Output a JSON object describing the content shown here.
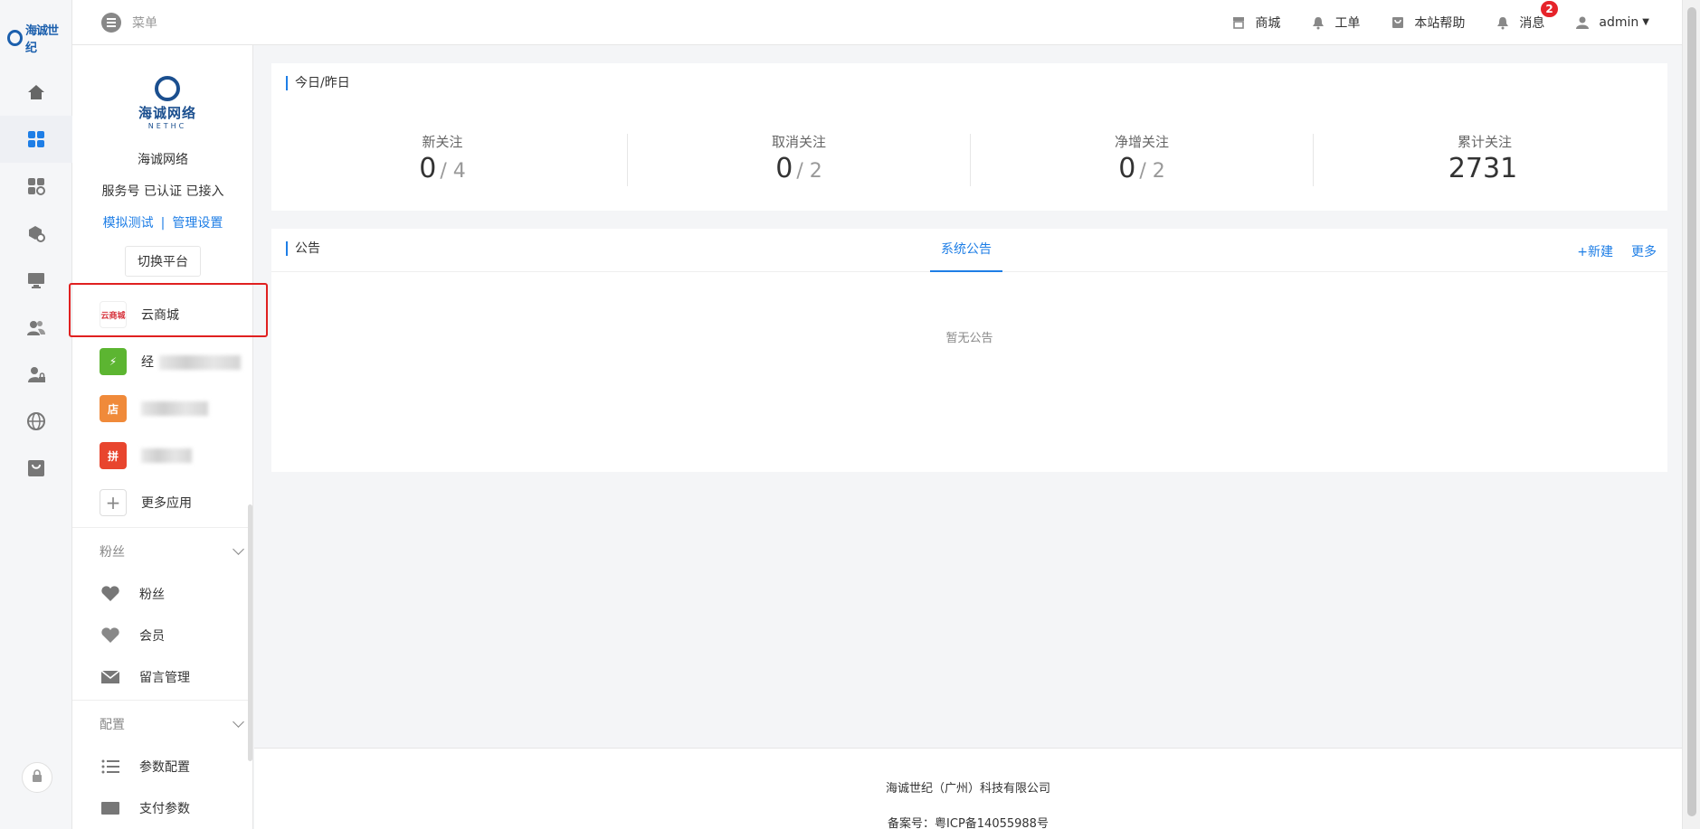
{
  "header": {
    "menu_label": "菜单",
    "items": [
      {
        "label": "商城",
        "icon": "store-icon"
      },
      {
        "label": "工单",
        "icon": "bell-icon"
      },
      {
        "label": "本站帮助",
        "icon": "bag-icon"
      },
      {
        "label": "消息",
        "icon": "bell-icon",
        "badge": "2"
      }
    ],
    "user": "admin"
  },
  "rail": {
    "logo_text": "海诚世纪",
    "items": [
      "home-icon",
      "grid-icon",
      "apps-settings-icon",
      "box-settings-icon",
      "monitor-icon",
      "users-icon",
      "user-lock-icon",
      "globe-icon",
      "shop-icon"
    ]
  },
  "account": {
    "logo_brand": "海诚网络",
    "logo_sub": "NETHC",
    "name": "海诚网络",
    "type": "服务号 已认证 已接入",
    "link_test": "模拟测试",
    "link_sep": "|",
    "link_manage": "管理设置",
    "switch_label": "切换平台"
  },
  "apps": [
    {
      "name": "云商城",
      "icon_text": "云商城",
      "color": "#d6303a"
    },
    {
      "name": "经",
      "icon_text": "⚡",
      "color": "#5cb531"
    },
    {
      "name": "",
      "icon_text": "店",
      "color": "#f08a3a"
    },
    {
      "name": "",
      "icon_text": "拼",
      "color": "#e8452e"
    },
    {
      "name": "更多应用",
      "icon_text": "+",
      "color": "#ffffff"
    }
  ],
  "groups": {
    "fans": {
      "title": "粉丝",
      "items": [
        {
          "label": "粉丝",
          "icon": "heart-tag-icon"
        },
        {
          "label": "会员",
          "icon": "heart-icon"
        },
        {
          "label": "留言管理",
          "icon": "mail-icon"
        }
      ]
    },
    "config": {
      "title": "配置",
      "items": [
        {
          "label": "参数配置",
          "icon": "list-icon"
        },
        {
          "label": "支付参数",
          "icon": "card-icon"
        }
      ]
    }
  },
  "stats": {
    "title": "今日/昨日",
    "items": [
      {
        "label": "新关注",
        "today": "0",
        "yesterday": "/ 4"
      },
      {
        "label": "取消关注",
        "today": "0",
        "yesterday": "/ 2"
      },
      {
        "label": "净增关注",
        "today": "0",
        "yesterday": "/ 2"
      },
      {
        "label": "累计关注",
        "today": "2731",
        "yesterday": ""
      }
    ]
  },
  "notice": {
    "title": "公告",
    "tab": "系统公告",
    "new_label": "+新建",
    "more_label": "更多",
    "empty": "暂无公告"
  },
  "footer": {
    "company": "海诚世纪（广州）科技有限公司",
    "icp": "备案号：粤ICP备14055988号"
  },
  "colors": {
    "accent": "#1e7ee6",
    "highlight": "#e02020",
    "badge": "#e6232a"
  }
}
